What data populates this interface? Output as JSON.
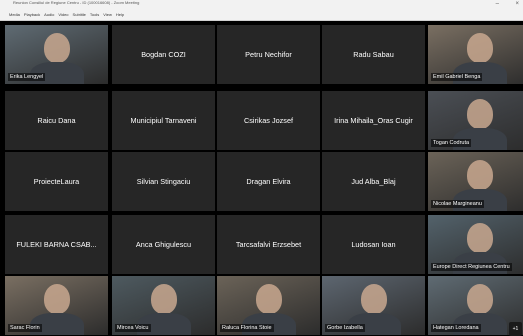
{
  "window": {
    "title": "Reunion Consiliul de Regiune Centru - ID (100016608) - Zoom Meeting",
    "minimize_icon": "minimize-icon",
    "close_icon": "close-icon"
  },
  "menu": [
    "Media",
    "Playback",
    "Audio",
    "Video",
    "Subtitle",
    "Tools",
    "View",
    "Help"
  ],
  "participants": [
    {
      "name": "Erika Lengyel",
      "video": true
    },
    {
      "name": "Bogdan COZI",
      "video": false
    },
    {
      "name": "Petru Nechifor",
      "video": false
    },
    {
      "name": "Radu Sabau",
      "video": false
    },
    {
      "name": "Emil Gabriel Benga",
      "video": true
    },
    {
      "name": "Raicu Dana",
      "video": false
    },
    {
      "name": "Municipiul Tarnaveni",
      "video": false
    },
    {
      "name": "Csirikas Jozsef",
      "video": false
    },
    {
      "name": "Irina Mihaila_Oras Cugir",
      "video": false
    },
    {
      "name": "Togan Codruta",
      "video": true
    },
    {
      "name": "ProiecteLaura",
      "video": false
    },
    {
      "name": "Silvian Stingaciu",
      "video": false
    },
    {
      "name": "Dragan Elvira",
      "video": false
    },
    {
      "name": "Jud Alba_Blaj",
      "video": false
    },
    {
      "name": "Nicolae Margineanu",
      "video": true
    },
    {
      "name": "FULEKI BARNA CSAB...",
      "video": false
    },
    {
      "name": "Anca Ghigulescu",
      "video": false
    },
    {
      "name": "Tarcsafalvi Erzsebet",
      "video": false
    },
    {
      "name": "Ludosan Ioan",
      "video": false
    },
    {
      "name": "Europe Direct Regiunea Centru",
      "video": true
    },
    {
      "name": "Sarac Florin",
      "video": true
    },
    {
      "name": "Mircea Voicu",
      "video": true
    },
    {
      "name": "Raluca Florina Stoie",
      "video": true
    },
    {
      "name": "Gorbe Izabella",
      "video": true
    },
    {
      "name": "Hategan Loredana",
      "video": true
    }
  ],
  "more_button": "+1"
}
